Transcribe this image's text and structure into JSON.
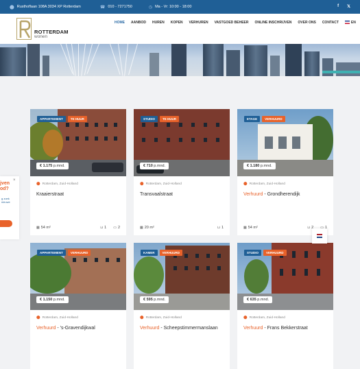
{
  "topbar": {
    "address": "Rusthoflaan 108A 3034 XP Rotterdam",
    "phone": "010 - 7271750",
    "hours": "Ma - Vr: 10:00 - 18:00",
    "social": [
      "f",
      "𝕏"
    ]
  },
  "logo": {
    "name": "ROTTERDAM",
    "sub": "wonen"
  },
  "nav": {
    "items": [
      "HOME",
      "AANBOD",
      "HUREN",
      "KOPEN",
      "VERHUREN",
      "VASTGOED BEHEER",
      "ONLINE INSCHRIJVEN",
      "OVER ONS",
      "CONTACT"
    ],
    "language": "EN"
  },
  "listings": [
    {
      "type": "APPARTEMENT",
      "status": "TE HUUR",
      "price": "€ 1.175",
      "unit": "p.mnd.",
      "location": "Rotterdam, Zuid-Holland",
      "rented_prefix": "",
      "title": "Kraaierstraat",
      "area": "54 m²",
      "baths": "1",
      "rooms": "2"
    },
    {
      "type": "STUDIO",
      "status": "TE HUUR",
      "price": "€ 710",
      "unit": "p.mnd.",
      "location": "Rotterdam, Zuid-Holland",
      "rented_prefix": "",
      "title": "Transvaalstraat",
      "area": "20 m²",
      "baths": "1",
      "rooms": ""
    },
    {
      "type": "ETAGE",
      "status": "VERHUURD",
      "price": "€ 1.180",
      "unit": "p.mnd.",
      "location": "Rotterdam, Zuid-Holland",
      "rented_prefix": "Verhuurd",
      "title": " - Grondherendijk",
      "area": "54 m²",
      "baths": "2",
      "rooms": "1"
    },
    {
      "type": "APPARTEMENT",
      "status": "VERHUURD",
      "price": "€ 1.150",
      "unit": "p.mnd.",
      "location": "Rotterdam, Zuid-Holland",
      "rented_prefix": "Verhuurd",
      "title": " - 's-Gravendijkwal",
      "area": "",
      "baths": "",
      "rooms": ""
    },
    {
      "type": "KAMER",
      "status": "VERHUURD",
      "price": "€ 595",
      "unit": "p.mnd.",
      "location": "Rotterdam, Zuid-Holland",
      "rented_prefix": "Verhuurd",
      "title": " - Scheepstimmermanslaan",
      "area": "",
      "baths": "",
      "rooms": ""
    },
    {
      "type": "STUDIO",
      "status": "VERHUURD",
      "price": "€ 635",
      "unit": "p.mnd.",
      "location": "Rotterdam, Zuid-Holland",
      "rented_prefix": "Verhuurd",
      "title": " - Frans Bekkerstraat",
      "area": "",
      "baths": "",
      "rooms": ""
    }
  ],
  "side_widget": {
    "question": "jven\nod?",
    "close": "×",
    "small_text": "g zoek\nnieuwe"
  },
  "icons": {
    "pin": "map-pin-icon",
    "area": "floor-area-icon",
    "bath": "bath-icon",
    "bed": "bed-icon"
  },
  "colors": {
    "primary": "#1f5f96",
    "accent": "#e8622a"
  }
}
